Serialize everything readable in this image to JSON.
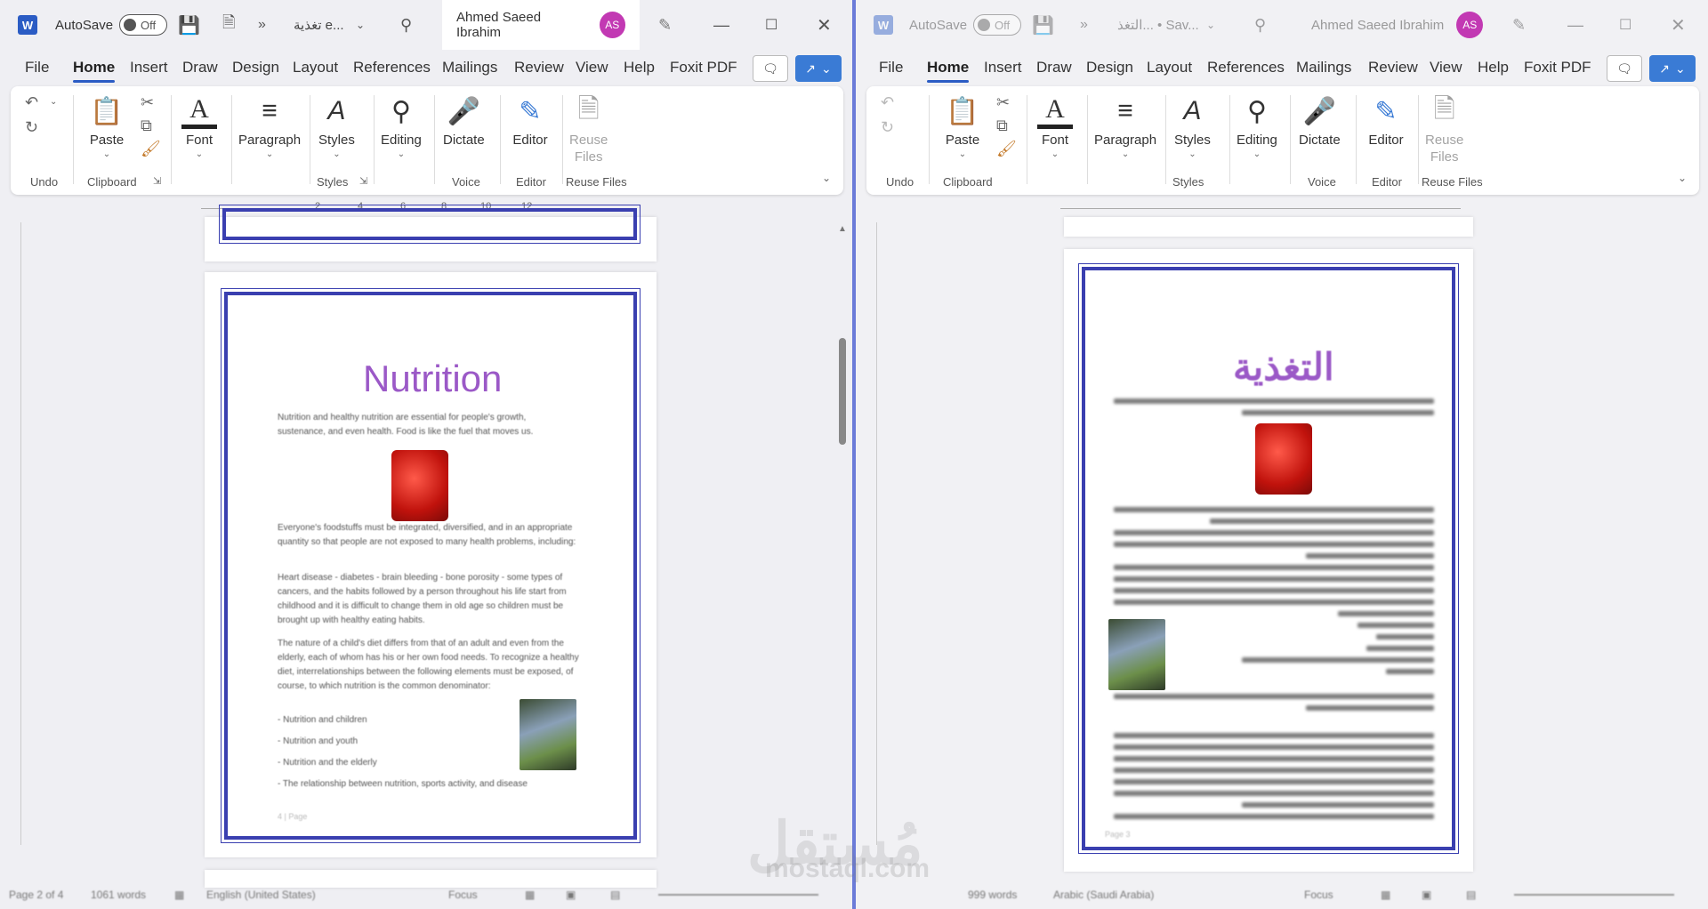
{
  "left": {
    "autosave_label": "AutoSave",
    "autosave_state": "Off",
    "doc_name": "تغذية e...",
    "account_name": "Ahmed Saeed Ibrahim",
    "avatar_initials": "AS",
    "menu": [
      "File",
      "Home",
      "Insert",
      "Draw",
      "Design",
      "Layout",
      "References",
      "Mailings",
      "Review",
      "View",
      "Help",
      "Foxit PDF"
    ],
    "ribbon": {
      "paste": "Paste",
      "font": "Font",
      "paragraph": "Paragraph",
      "styles": "Styles",
      "editing": "Editing",
      "dictate": "Dictate",
      "editor": "Editor",
      "reuse_line1": "Reuse",
      "reuse_line2": "Files",
      "groups": {
        "undo": "Undo",
        "clipboard": "Clipboard",
        "styles": "Styles",
        "voice": "Voice",
        "editor": "Editor",
        "reuse": "Reuse Files"
      }
    },
    "ruler_ticks": [
      "2",
      "4",
      "6",
      "8",
      "10",
      "12"
    ],
    "document": {
      "title": "Nutrition",
      "p1": "Nutrition and healthy nutrition are essential for people's growth, sustenance, and even health. Food is like the fuel that moves us.",
      "p2": "Everyone's foodstuffs must be integrated, diversified, and in an appropriate quantity so that people are not exposed to many health problems, including:",
      "p3": "Heart disease - diabetes - brain bleeding - bone porosity - some types of cancers, and the habits followed by a person throughout his life start from childhood and it is difficult to change them in old age so children must be brought up with healthy eating habits.",
      "p4": "The nature of a child's diet differs from that of an adult and even from the elderly, each of whom has his or her own food needs. To recognize a healthy diet, interrelationships between the following elements must be exposed, of course, to which nutrition is the common denominator:",
      "bullets": [
        "- Nutrition and children",
        "- Nutrition and youth",
        "- Nutrition and the elderly",
        "- The relationship between nutrition, sports activity, and disease"
      ],
      "footer": "4 | Page"
    },
    "status": {
      "page": "Page 2 of 4",
      "words": "1061 words",
      "language": "English (United States)",
      "focus": "Focus"
    }
  },
  "right": {
    "autosave_label": "AutoSave",
    "autosave_state": "Off",
    "doc_name": "التغذ... • Sav...",
    "account_name": "Ahmed Saeed Ibrahim",
    "avatar_initials": "AS",
    "menu": [
      "File",
      "Home",
      "Insert",
      "Draw",
      "Design",
      "Layout",
      "References",
      "Mailings",
      "Review",
      "View",
      "Help",
      "Foxit PDF"
    ],
    "ribbon": {
      "paste": "Paste",
      "font": "Font",
      "paragraph": "Paragraph",
      "styles": "Styles",
      "editing": "Editing",
      "dictate": "Dictate",
      "editor": "Editor",
      "reuse_line1": "Reuse",
      "reuse_line2": "Files",
      "groups": {
        "undo": "Undo",
        "clipboard": "Clipboard",
        "styles": "Styles",
        "voice": "Voice",
        "editor": "Editor",
        "reuse": "Reuse Files"
      }
    },
    "document": {
      "title": "التغذية",
      "footer": "Page 3"
    },
    "status": {
      "words": "999 words",
      "language": "Arabic (Saudi Arabia)",
      "focus": "Focus"
    }
  },
  "watermark": {
    "main": "مُستقل",
    "sub": "mostaql.com"
  },
  "colors": {
    "accent": "#2b5cc4",
    "avatar": "#c239b3",
    "frame": "#3a3fb0",
    "title": "#9b59c7"
  }
}
